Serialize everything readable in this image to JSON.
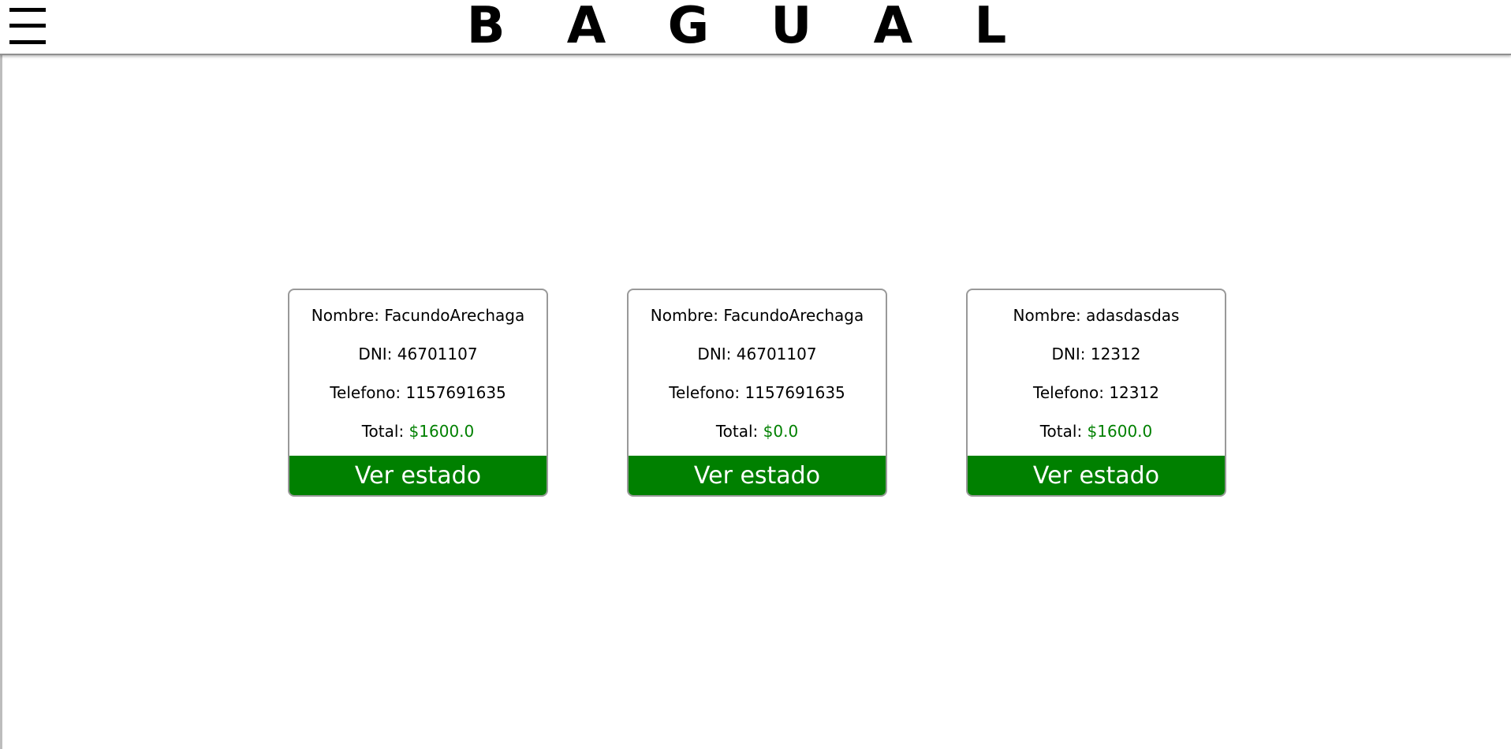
{
  "header": {
    "brand": "B A G U A L",
    "menu_icon": "hamburger-menu-icon"
  },
  "labels": {
    "nombre": "Nombre:",
    "dni": "DNI:",
    "telefono": "Telefono:",
    "total": "Total:"
  },
  "clients": [
    {
      "nombre": "FacundoArechaga",
      "dni": "46701107",
      "telefono": "1157691635",
      "total": "$1600.0",
      "button_label": "Ver estado"
    },
    {
      "nombre": "FacundoArechaga",
      "dni": "46701107",
      "telefono": "1157691635",
      "total": "$0.0",
      "button_label": "Ver estado"
    },
    {
      "nombre": "adasdasdas",
      "dni": "12312",
      "telefono": "12312",
      "total": "$1600.0",
      "button_label": "Ver estado"
    }
  ],
  "colors": {
    "accent": "#008000",
    "border": "#999999"
  }
}
